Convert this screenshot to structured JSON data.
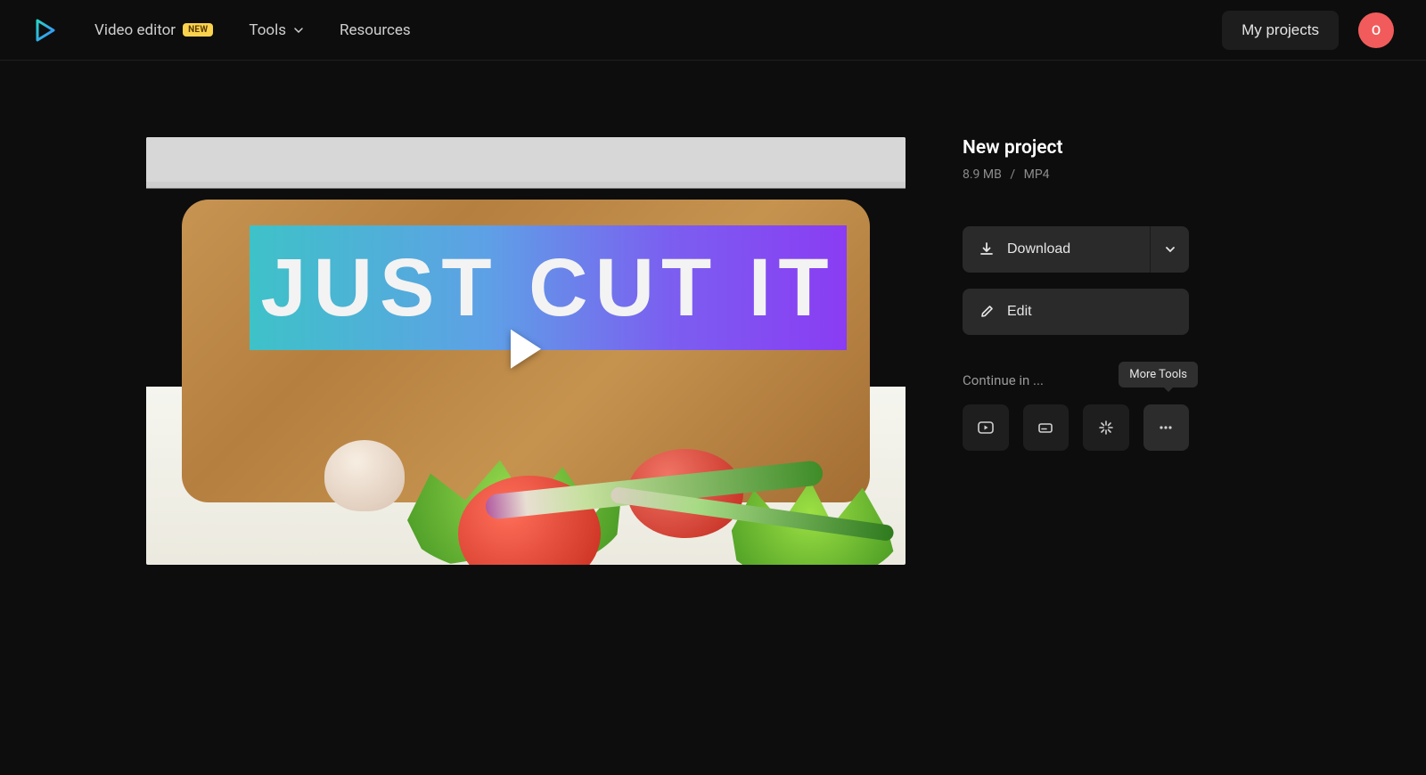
{
  "nav": {
    "video_editor": "Video editor",
    "badge": "NEW",
    "tools": "Tools",
    "resources": "Resources"
  },
  "header": {
    "my_projects": "My projects",
    "avatar_initial": "O"
  },
  "preview": {
    "overlay_text": "JUST CUT IT"
  },
  "project": {
    "title": "New project",
    "size": "8.9 MB",
    "format": "MP4"
  },
  "buttons": {
    "download": "Download",
    "edit": "Edit"
  },
  "continue": {
    "label": "Continue in ...",
    "tooltip": "More Tools"
  }
}
